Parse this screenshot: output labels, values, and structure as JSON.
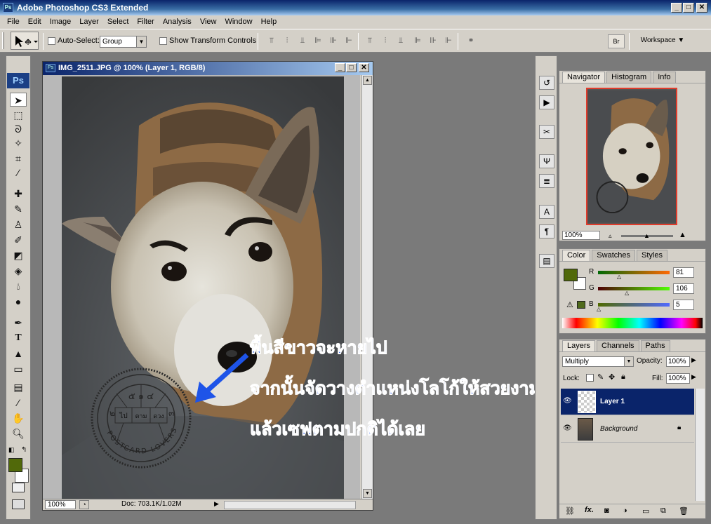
{
  "app": {
    "title": "Adobe Photoshop CS3 Extended",
    "icon_label": "Ps",
    "window_buttons": [
      "_",
      "□",
      "✕"
    ]
  },
  "menu": [
    "File",
    "Edit",
    "Image",
    "Layer",
    "Select",
    "Filter",
    "Analysis",
    "View",
    "Window",
    "Help"
  ],
  "options_bar": {
    "auto_select_label": "Auto-Select:",
    "auto_select_value": "Group",
    "show_transform_label": "Show Transform Controls",
    "workspace_label": "Workspace ▼"
  },
  "document": {
    "title": "IMG_2511.JPG @ 100% (Layer 1, RGB/8)",
    "zoom": "100%",
    "doc_size": "Doc: 703.1K/1.02M"
  },
  "annotation": {
    "line1": "พื้นสีขาวจะหายไป",
    "line2": "จากนั้นจัดวางตำแหน่งโลโก้ให้สวยงาม",
    "line3": "แล้วเซฟตามปกติได้เลย",
    "color": "#1e54e8"
  },
  "stamp": {
    "top_digits": "๕ ๑ ๔",
    "left_digit": "๒",
    "right_digit": "๓",
    "cells": [
      "ไป",
      "ตาม",
      "ดวง"
    ],
    "ring_text": "POSTCARD LOVERS"
  },
  "navigator": {
    "tabs": [
      "Navigator",
      "Histogram",
      "Info"
    ],
    "zoom": "100%"
  },
  "color_panel": {
    "tabs": [
      "Color",
      "Swatches",
      "Styles"
    ],
    "r_label": "R",
    "r_value": "81",
    "g_label": "G",
    "g_value": "106",
    "b_label": "B",
    "b_value": "5",
    "foreground": "#51690a"
  },
  "layers_panel": {
    "tabs": [
      "Layers",
      "Channels",
      "Paths"
    ],
    "blend_mode": "Multiply",
    "opacity_label": "Opacity:",
    "opacity_value": "100%",
    "lock_label": "Lock:",
    "fill_label": "Fill:",
    "fill_value": "100%",
    "layers": [
      {
        "name": "Layer 1",
        "selected": true
      },
      {
        "name": "Background",
        "selected": false
      }
    ],
    "footer_fx": "fx."
  }
}
